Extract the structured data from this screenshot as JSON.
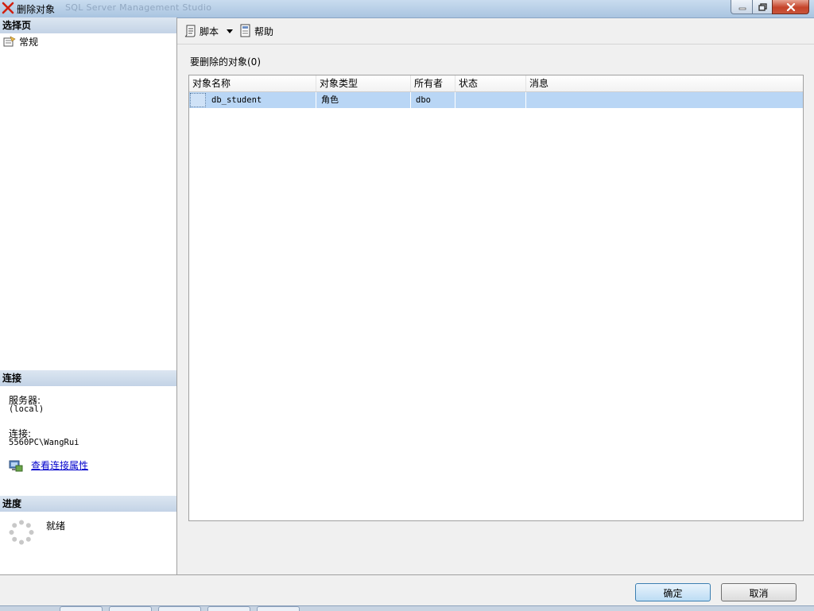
{
  "window": {
    "title": "删除对象",
    "title_ghost": "SQL Server Management Studio"
  },
  "left": {
    "select_page_header": "选择页",
    "pages": [
      {
        "label": "常规"
      }
    ],
    "connection_header": "连接",
    "server_label": "服务器:",
    "server_value": "(local)",
    "connection_label": "连接:",
    "connection_value": "5560PC\\WangRui",
    "view_connection_link": "查看连接属性",
    "progress_header": "进度",
    "progress_status": "就绪"
  },
  "toolbar": {
    "script_label": "脚本",
    "help_label": "帮助"
  },
  "main": {
    "objects_label": "要删除的对象(0)",
    "columns": [
      "对象名称",
      "对象类型",
      "所有者",
      "状态",
      "消息"
    ],
    "rows": [
      {
        "name": "db_student",
        "type": "角色",
        "owner": "dbo",
        "status": "",
        "message": ""
      }
    ]
  },
  "buttons": {
    "ok": "确定",
    "cancel": "取消"
  },
  "colors": {
    "selection": "#b9d6f5",
    "link": "#0000cc",
    "close_button": "#c5432a"
  }
}
